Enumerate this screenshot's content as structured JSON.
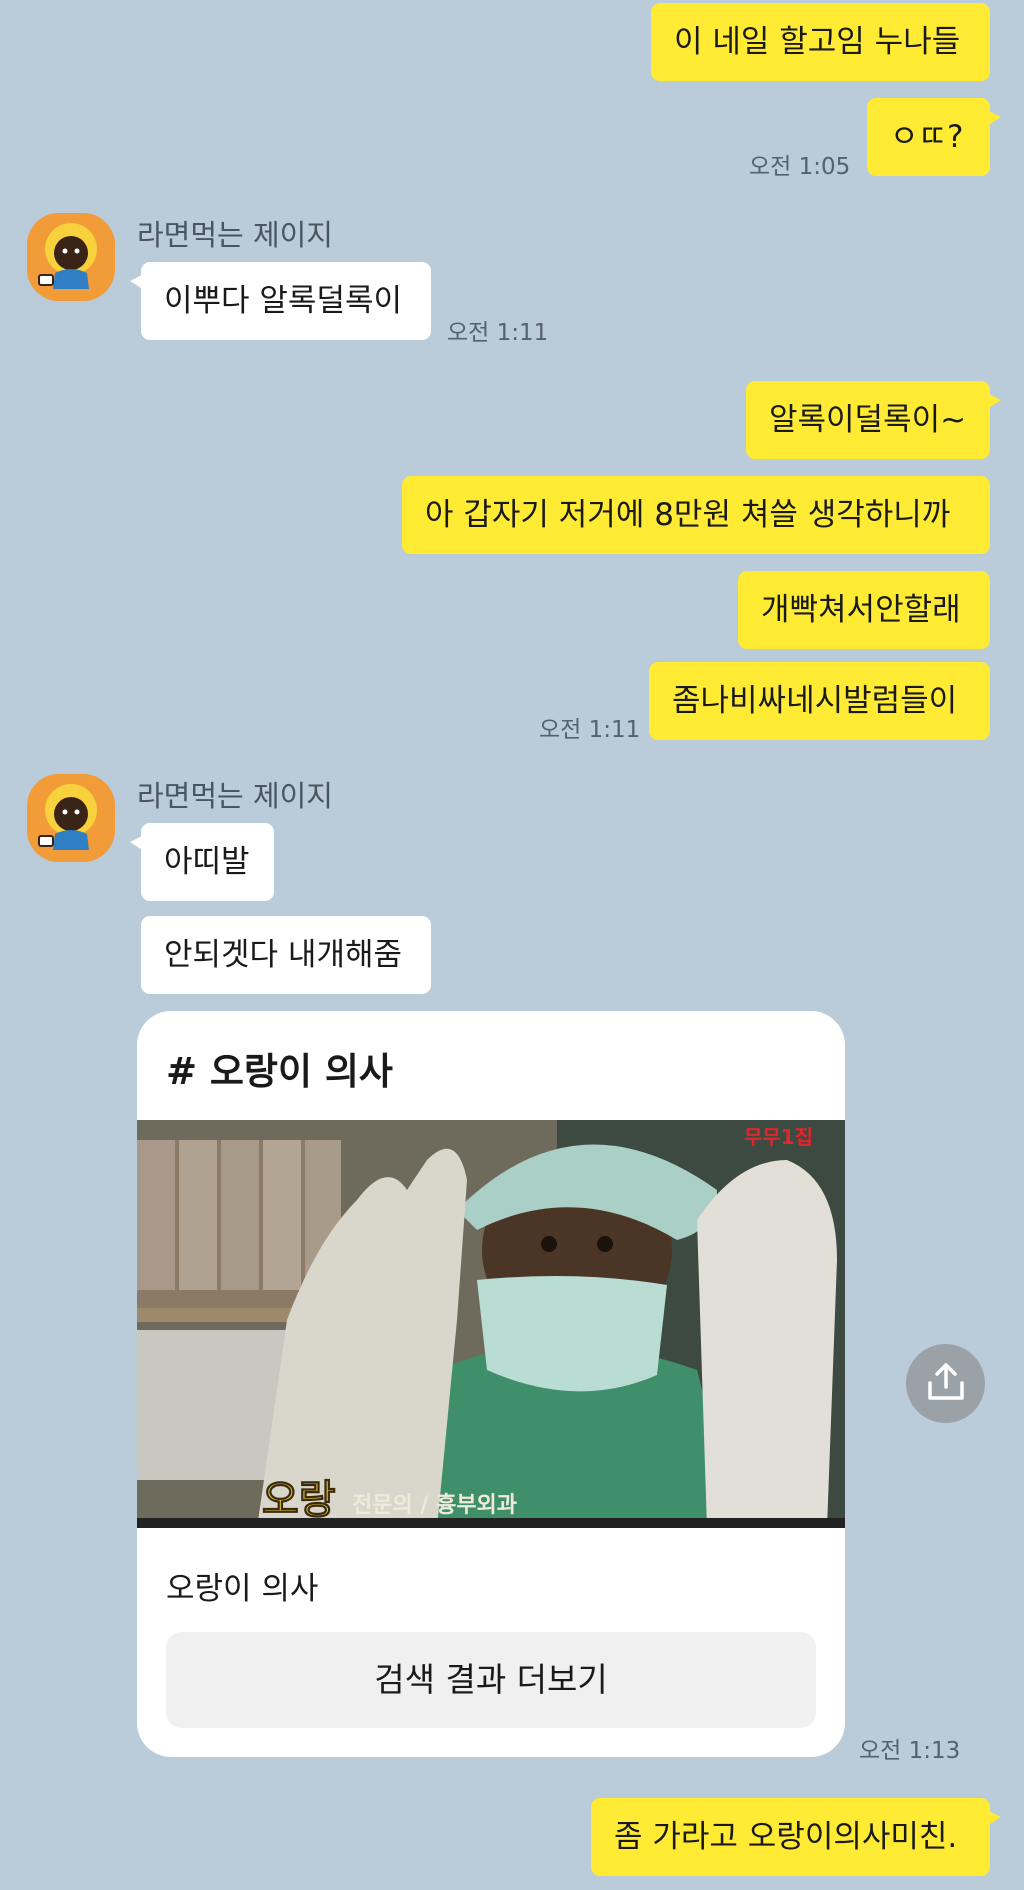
{
  "messages": {
    "m1": "이 네일 할고임 누나들",
    "m2": "ㅇㄸ?",
    "m1_time": "오전 1:05",
    "them1_sender": "라면먹는 제이지",
    "them1_text": "이뿌다 알록덜록이",
    "them1_time": "오전 1:11",
    "m3": "알록이덜록이~",
    "m4": "아 갑자기 저거에 8만원 쳐쓸 생각하니까",
    "m5": "개빡쳐서안할래",
    "m6": "좀나비싸네시발럼들이",
    "m3_time": "오전 1:11",
    "them2_sender": "라면먹는 제이지",
    "them2_text1": "아띠발",
    "them2_text2": "안되겟다 내개해줌",
    "card_title": "# 오랑이 의사",
    "card_caption_name": "오랑",
    "card_caption_sub": "전문의 / 흉부외과",
    "card_channel_mark": "무무1집",
    "card_subtitle": "오랑이 의사",
    "card_button": "검색 결과 더보기",
    "card_time": "오전 1:13",
    "m7": "좀 가라고 오랑이의사미친."
  },
  "icons": {
    "avatar": "character-avatar-icon",
    "share": "share-upload-icon"
  },
  "colors": {
    "background": "#bacbd9",
    "my_bubble": "#ffeb33",
    "their_bubble": "#ffffff",
    "avatar_bg": "#f29b39",
    "share_button": "#9aa2a8"
  }
}
